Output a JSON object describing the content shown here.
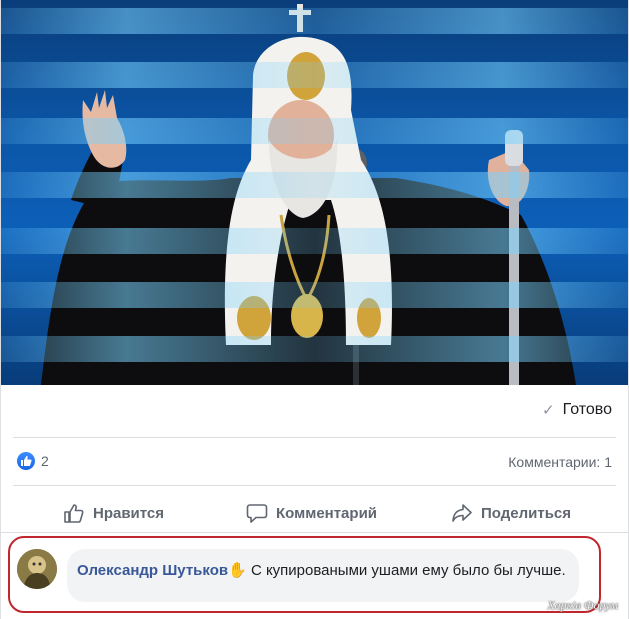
{
  "post": {
    "photo_icon": "patriarch-photo",
    "ready_label": "Готово",
    "like_count": "2",
    "comments_count": "Комментарии: 1",
    "actions": {
      "like": "Нравится",
      "comment": "Комментарий",
      "share": "Поделиться"
    }
  },
  "comment": {
    "author": "Олександр Шутьков",
    "text": "С купироваными ушами ему было бы лучше."
  },
  "watermark": "Харків Форум",
  "colors": {
    "author_link": "#385898",
    "like_blue": "#1a66e6",
    "highlight_border": "#c0262d"
  }
}
